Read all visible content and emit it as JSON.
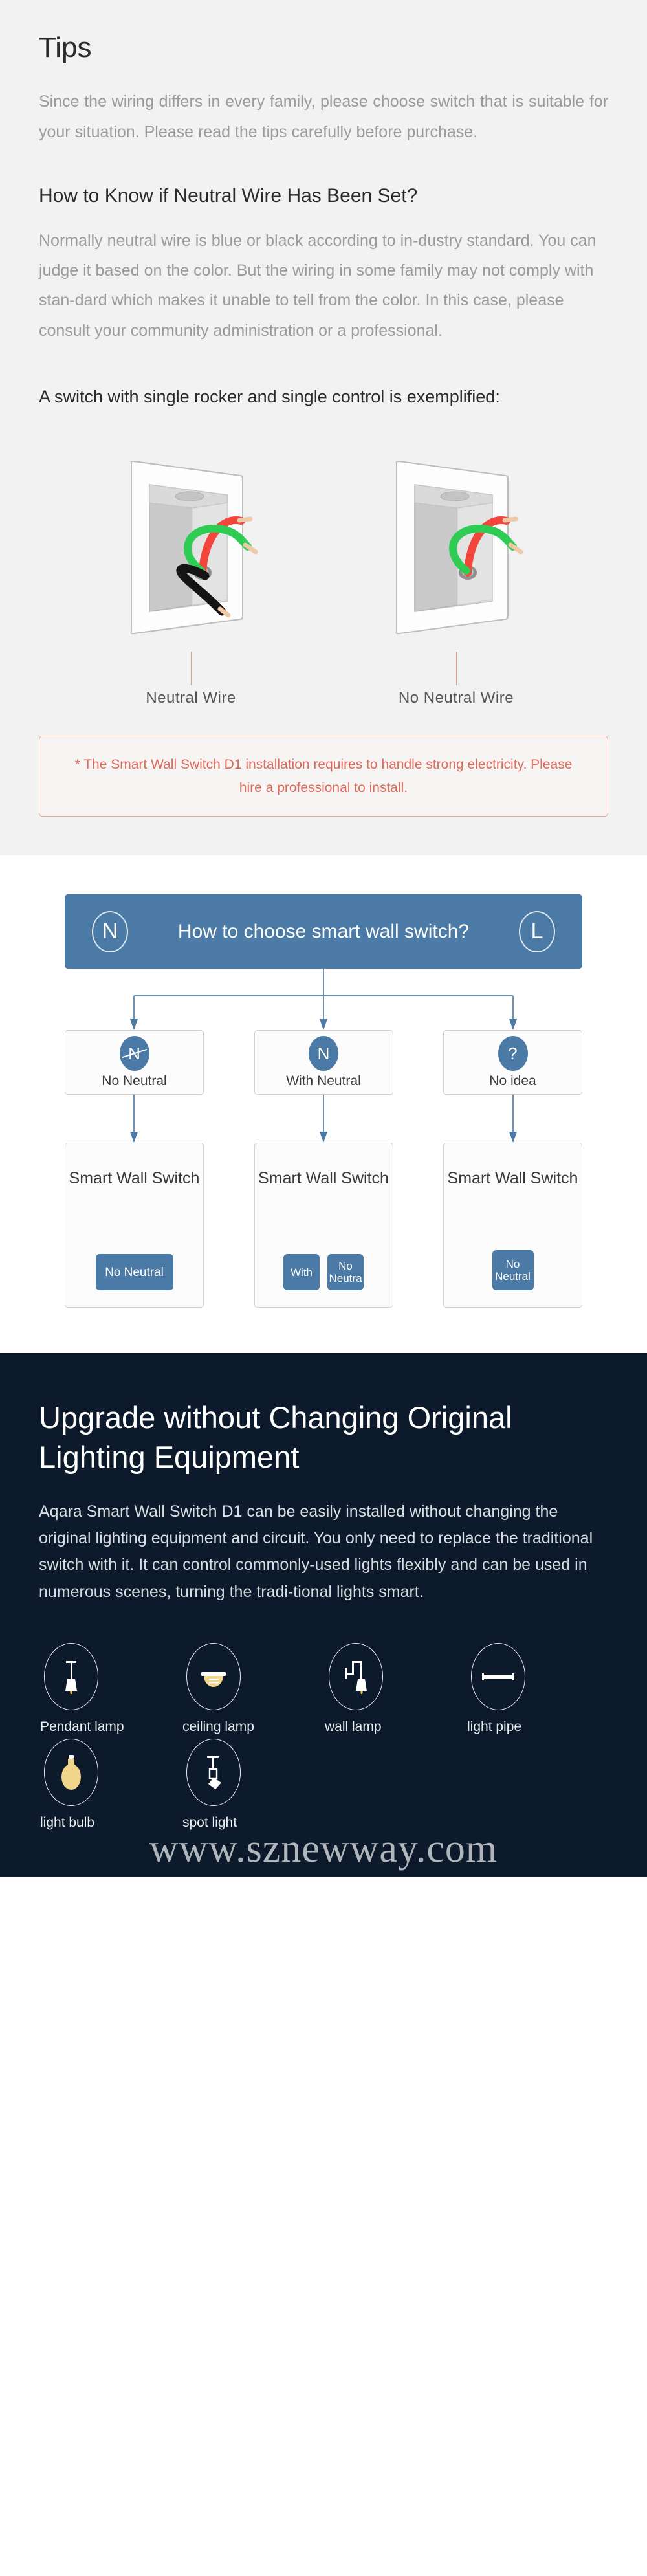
{
  "tips": {
    "title": "Tips",
    "intro": "Since the wiring differs in every family, please choose switch that is suitable for your situation. Please read the tips carefully before purchase.",
    "neutral_heading": "How to Know if Neutral Wire Has Been Set?",
    "neutral_body": "Normally neutral wire is blue or black according to in-dustry standard. You can judge it based on the color. But the wiring in some family may not comply with stan-dard which makes it unable to tell from the color. In this case, please consult your community administration or a professional.",
    "example_lead": "A switch with single rocker and single control is exemplified:",
    "switches": [
      {
        "caption": "Neutral Wire"
      },
      {
        "caption": "No Neutral Wire"
      }
    ],
    "warning": "* The Smart Wall Switch D1 installation requires to handle strong electricity. Please hire a professional to install."
  },
  "flowchart": {
    "header": {
      "left_badge": "N",
      "right_badge": "L",
      "title": "How to choose smart wall switch?"
    },
    "options": [
      {
        "badge": "N",
        "badge_type": "no-neutral",
        "label": "No Neutral"
      },
      {
        "badge": "N",
        "badge_type": "neutral",
        "label": "With Neutral"
      },
      {
        "badge": "?",
        "badge_type": "question",
        "label": "No idea"
      }
    ],
    "results": [
      {
        "title": "Smart Wall Switch",
        "chips": [
          {
            "text": "No Neutral",
            "size": "wide"
          }
        ]
      },
      {
        "title": "Smart Wall Switch",
        "chips": [
          {
            "text": "With",
            "size": "small"
          },
          {
            "text": "No Neutra",
            "size": "small"
          }
        ]
      },
      {
        "title": "Smart Wall Switch",
        "chips": [
          {
            "text": "No Neutral",
            "size": "med"
          }
        ]
      }
    ]
  },
  "upgrade": {
    "title": "Upgrade without Changing Original Lighting Equipment",
    "body": "Aqara Smart Wall Switch D1 can be easily installed without changing the original lighting equipment and circuit. You only need to replace the traditional switch with it. It can control commonly-used lights flexibly and can be used in numerous scenes, turning the tradi-tional lights smart.",
    "lamps": [
      {
        "label": "Pendant lamp",
        "icon": "pendant-lamp-icon"
      },
      {
        "label": "ceiling lamp",
        "icon": "ceiling-lamp-icon"
      },
      {
        "label": "wall lamp",
        "icon": "wall-lamp-icon"
      },
      {
        "label": "light pipe",
        "icon": "light-pipe-icon"
      },
      {
        "label": "light bulb",
        "icon": "light-bulb-icon"
      },
      {
        "label": "spot light",
        "icon": "spot-light-icon"
      }
    ],
    "watermark": "www.sznewway.com"
  },
  "colors": {
    "accent_blue": "#4a7aa5",
    "dark_bg": "#0d1a2b",
    "warning_red": "#e0695a",
    "wire_red": "#f2463c",
    "wire_green": "#2ecc53"
  }
}
